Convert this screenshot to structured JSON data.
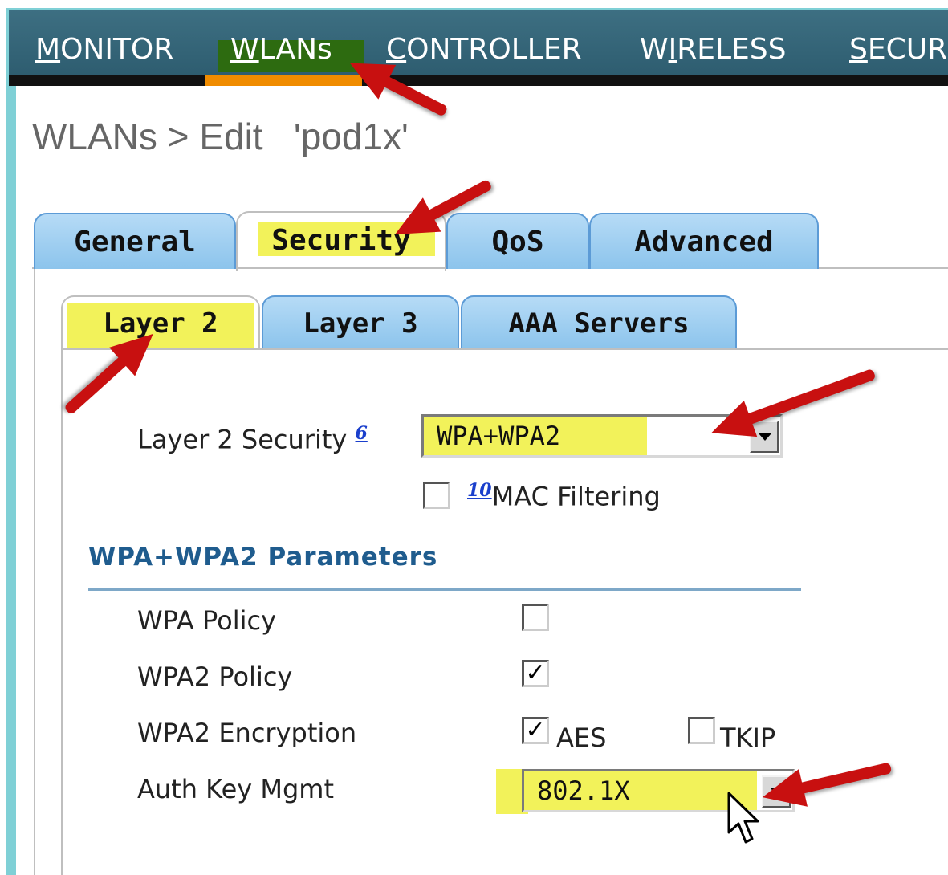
{
  "nav": {
    "items": [
      {
        "label_first": "M",
        "label_rest": "ONITOR"
      },
      {
        "label_first": "W",
        "label_rest": "LANs"
      },
      {
        "label_first": "C",
        "label_rest": "ONTROLLER"
      },
      {
        "label_before": "W",
        "label_first": "I",
        "label_rest": "RELESS"
      },
      {
        "label_first": "S",
        "label_rest": "ECUR"
      }
    ],
    "active": "WLANs"
  },
  "page": {
    "title": "WLANs > Edit   'pod1x'"
  },
  "tabs": {
    "items": [
      "General",
      "Security",
      "QoS",
      "Advanced"
    ],
    "active": "Security"
  },
  "subtabs": {
    "items": [
      "Layer 2",
      "Layer 3",
      "AAA Servers"
    ],
    "active": "Layer 2"
  },
  "layer2": {
    "security_label": "Layer 2 Security",
    "security_ref": "6",
    "security_value": "WPA+WPA2",
    "mac_filtering_ref": "10",
    "mac_filtering_label": "MAC Filtering",
    "mac_filtering_checked": false
  },
  "wpa": {
    "section_title": "WPA+WPA2 Parameters",
    "wpa_policy_label": "WPA Policy",
    "wpa_policy_checked": false,
    "wpa2_policy_label": "WPA2 Policy",
    "wpa2_policy_checked": true,
    "wpa2_encryption_label": "WPA2 Encryption",
    "aes_label": "AES",
    "aes_checked": true,
    "tkip_label": "TKIP",
    "tkip_checked": false,
    "auth_key_label": "Auth Key Mgmt",
    "auth_key_value": "802.1X"
  },
  "colors": {
    "nav_bg": "#3d6f82",
    "nav_active": "#f08c00",
    "highlight": "#f2f25a",
    "arrow": "#c81010",
    "tab_blue": "#8cc4ec"
  }
}
